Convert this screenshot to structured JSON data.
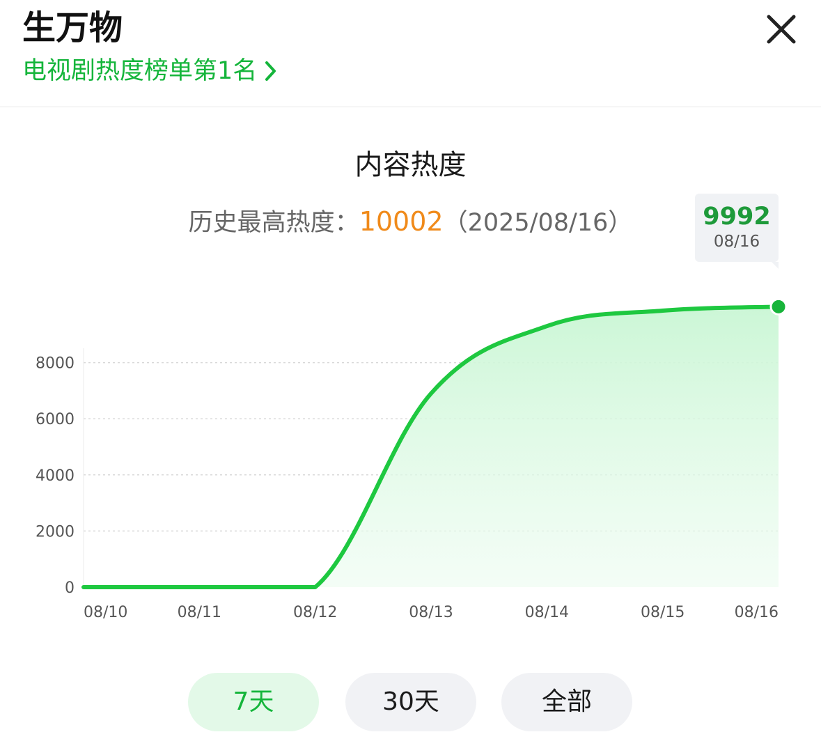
{
  "header": {
    "title": "生万物",
    "rank_link": "电视剧热度榜单第1名",
    "icons": {
      "rank_link": "chevron-right-icon",
      "close": "close-icon"
    }
  },
  "section": {
    "title": "内容热度",
    "record_label": "历史最高热度：",
    "record_value": "10002",
    "record_date": "（2025/08/16）"
  },
  "tooltip": {
    "value": "9992",
    "date": "08/16"
  },
  "range_buttons": [
    {
      "label": "7天",
      "active": true
    },
    {
      "label": "30天",
      "active": false
    },
    {
      "label": "全部",
      "active": false
    }
  ],
  "colors": {
    "accent": "#15b53b",
    "record_value": "#f08a1a",
    "line": "#1ec840",
    "area": "#d4f8dd",
    "active_button_bg": "#e3f9e8",
    "button_bg": "#f1f2f5"
  },
  "chart_data": {
    "type": "area",
    "title": "",
    "xlabel": "",
    "ylabel": "",
    "x": [
      "08/10",
      "08/11",
      "08/12",
      "08/13",
      "08/14",
      "08/15",
      "08/16"
    ],
    "series": [
      {
        "values": [
          0,
          0,
          0,
          6900,
          9300,
          9850,
          9992
        ]
      }
    ],
    "yticks": [
      0,
      2000,
      4000,
      6000,
      8000
    ],
    "ylim": [
      0,
      10000
    ],
    "grid": true,
    "highlight": {
      "x": "08/16",
      "value": 9992
    }
  }
}
